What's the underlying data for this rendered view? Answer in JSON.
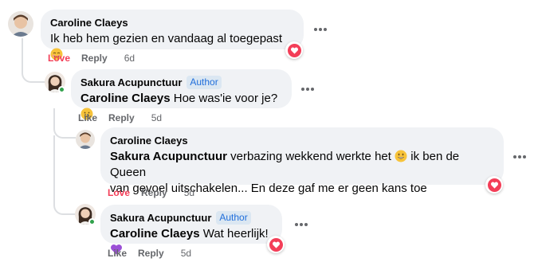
{
  "comments": [
    {
      "author": "Caroline Claeys",
      "badge": "",
      "mention": "",
      "text": "Ik heb hem gezien en vandaag al toegepast",
      "emoji": "smiling-blush-emoji",
      "actions": {
        "like": "Love",
        "reply": "Reply",
        "time": "6d"
      },
      "reaction": "heart-reaction"
    },
    {
      "author": "Sakura Acupunctuur",
      "badge": "Author",
      "mention": "Caroline Claeys",
      "text": "Hoe was'ie voor je?",
      "emoji": "smiling-face-emoji",
      "actions": {
        "like": "Like",
        "reply": "Reply",
        "time": "5d"
      }
    },
    {
      "author": "Caroline Claeys",
      "badge": "",
      "mention": "Sakura Acupunctuur",
      "text_line1": "verbazing wekkend werkte het",
      "text_line1_after": "ik ben de Queen",
      "text_line2": "van gevoel uitschakelen... En deze gaf me er geen kans toe",
      "emoji": "grinning-face-emoji",
      "actions": {
        "like": "Love",
        "reply": "Reply",
        "time": "5d"
      },
      "reaction": "heart-reaction"
    },
    {
      "author": "Sakura Acupunctuur",
      "badge": "Author",
      "mention": "Caroline Claeys",
      "text": "Wat heerlijk!",
      "emoji": "purple-heart-emoji",
      "actions": {
        "like": "Like",
        "reply": "Reply",
        "time": "5d"
      },
      "reaction": "heart-reaction"
    }
  ],
  "colors": {
    "bubble": "#f0f2f5",
    "love": "#f33e58",
    "secondary_text": "#65676b",
    "author_badge": "#216fdb"
  }
}
